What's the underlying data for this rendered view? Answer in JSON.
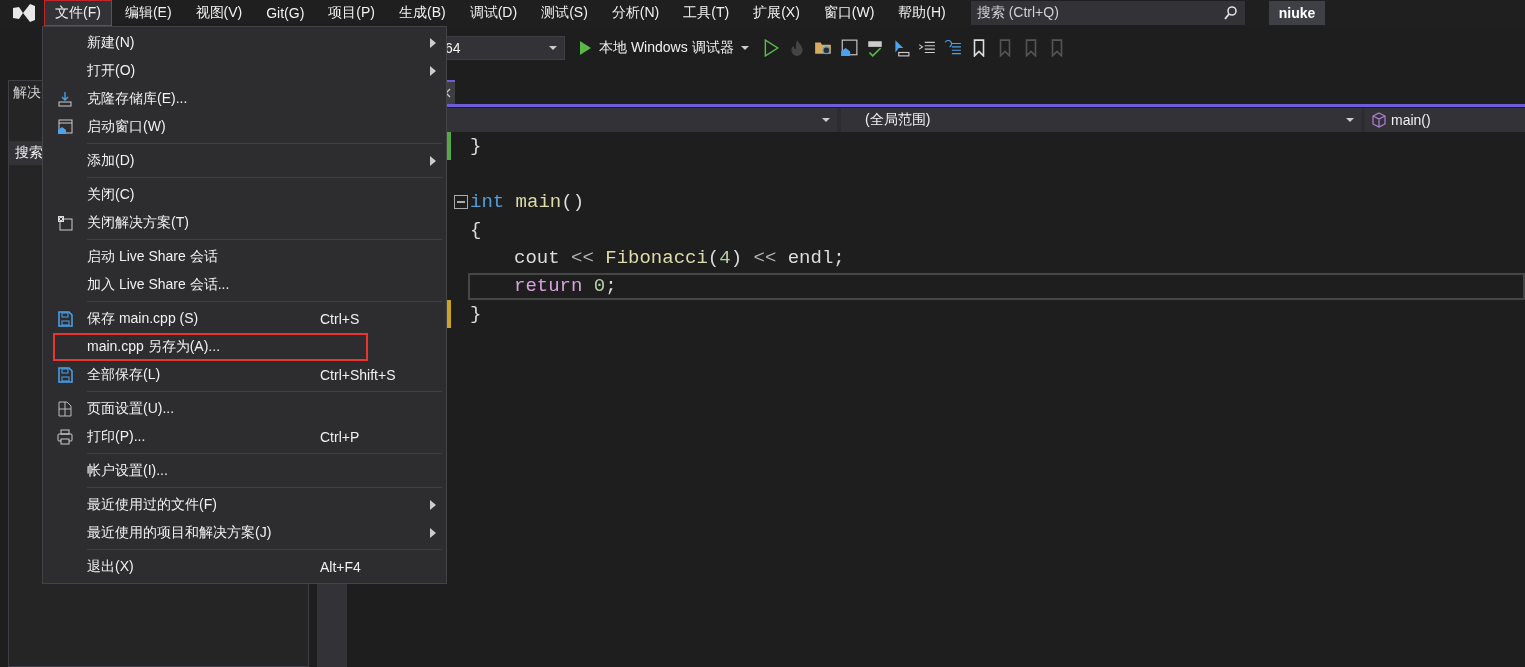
{
  "menubar": {
    "items": [
      {
        "label": "文件(F)",
        "selected": true
      },
      {
        "label": "编辑(E)",
        "selected": false
      },
      {
        "label": "视图(V)",
        "selected": false
      },
      {
        "label": "Git(G)",
        "selected": false
      },
      {
        "label": "项目(P)",
        "selected": false
      },
      {
        "label": "生成(B)",
        "selected": false
      },
      {
        "label": "调试(D)",
        "selected": false
      },
      {
        "label": "测试(S)",
        "selected": false
      },
      {
        "label": "分析(N)",
        "selected": false
      },
      {
        "label": "工具(T)",
        "selected": false
      },
      {
        "label": "扩展(X)",
        "selected": false
      },
      {
        "label": "窗口(W)",
        "selected": false
      },
      {
        "label": "帮助(H)",
        "selected": false
      }
    ],
    "search": {
      "placeholder": "搜索 (Ctrl+Q)"
    },
    "account": "niuke"
  },
  "toolbar": {
    "platform": "64",
    "run_label": "本地 Windows 调试器"
  },
  "solution_panel": {
    "title": "解决",
    "search_label": "搜索"
  },
  "editor": {
    "navbar": {
      "scope": "(全局范围)",
      "member": "main()"
    },
    "lines": [
      {
        "kind": "code",
        "color": "#57a64a",
        "fold": false,
        "indented": false,
        "current": false,
        "tokens": [
          {
            "kind": "punct",
            "text": "}"
          }
        ]
      },
      {
        "kind": "blank"
      },
      {
        "kind": "code",
        "fold": true,
        "indented": false,
        "current": false,
        "tokens": [
          {
            "kind": "keyword",
            "text": "int"
          },
          {
            "kind": "function",
            "text": "main"
          },
          {
            "kind": "punct",
            "text": "()"
          }
        ]
      },
      {
        "kind": "code",
        "fold": false,
        "indented": false,
        "current": false,
        "tokens": [
          {
            "kind": "punct",
            "text": "{"
          }
        ]
      },
      {
        "kind": "code",
        "fold": false,
        "indented": true,
        "current": false,
        "tokens": [
          {
            "kind": "variable",
            "text": "cout"
          },
          {
            "kind": "operator",
            "text": "<<"
          },
          {
            "kind": "function",
            "text": "Fibonacci"
          },
          {
            "kind": "punct",
            "text": "("
          },
          {
            "kind": "number",
            "text": "4"
          },
          {
            "kind": "punct",
            "text": ")"
          },
          {
            "kind": "operator",
            "text": "<<"
          },
          {
            "kind": "variable",
            "text": "endl"
          },
          {
            "kind": "punct",
            "text": ";"
          }
        ]
      },
      {
        "kind": "code",
        "fold": false,
        "indented": true,
        "current": true,
        "tokens": [
          {
            "kind": "control",
            "text": "return"
          },
          {
            "kind": "number",
            "text": "0"
          },
          {
            "kind": "punct",
            "text": ";"
          }
        ]
      },
      {
        "kind": "code",
        "color": "#c9a22a",
        "fold": false,
        "indented": false,
        "current": false,
        "tokens": [
          {
            "kind": "punct",
            "text": "}"
          }
        ]
      }
    ]
  },
  "file_menu": {
    "items": [
      {
        "kind": "item",
        "label": "新建(N)",
        "submenu": true,
        "highlighted": false
      },
      {
        "kind": "item",
        "label": "打开(O)",
        "submenu": true,
        "highlighted": false
      },
      {
        "kind": "item",
        "label": "克隆存储库(E)...",
        "submenu": false,
        "highlighted": false
      },
      {
        "kind": "item",
        "label": "启动窗口(W)",
        "submenu": false,
        "highlighted": false
      },
      {
        "kind": "separator"
      },
      {
        "kind": "item",
        "label": "添加(D)",
        "submenu": true,
        "highlighted": false
      },
      {
        "kind": "separator"
      },
      {
        "kind": "item",
        "label": "关闭(C)",
        "submenu": false,
        "highlighted": false
      },
      {
        "kind": "item",
        "label": "关闭解决方案(T)",
        "submenu": false,
        "highlighted": false
      },
      {
        "kind": "separator"
      },
      {
        "kind": "item",
        "label": "启动 Live Share 会话",
        "submenu": false,
        "highlighted": false
      },
      {
        "kind": "item",
        "label": "加入 Live Share 会话...",
        "submenu": false,
        "highlighted": false
      },
      {
        "kind": "separator"
      },
      {
        "kind": "item",
        "label": "保存 main.cpp (S)",
        "shortcut": "Ctrl+S",
        "submenu": false,
        "highlighted": false
      },
      {
        "kind": "item",
        "label": "main.cpp 另存为(A)...",
        "submenu": false,
        "highlighted": true
      },
      {
        "kind": "item",
        "label": "全部保存(L)",
        "shortcut": "Ctrl+Shift+S",
        "submenu": false,
        "highlighted": false
      },
      {
        "kind": "separator"
      },
      {
        "kind": "item",
        "label": "页面设置(U)...",
        "submenu": false,
        "highlighted": false
      },
      {
        "kind": "item",
        "label": "打印(P)...",
        "shortcut": "Ctrl+P",
        "submenu": false,
        "highlighted": false
      },
      {
        "kind": "separator"
      },
      {
        "kind": "item",
        "label": "帐户设置(I)...",
        "submenu": false,
        "highlighted": false
      },
      {
        "kind": "separator"
      },
      {
        "kind": "item",
        "label": "最近使用过的文件(F)",
        "submenu": true,
        "highlighted": false
      },
      {
        "kind": "item",
        "label": "最近使用的项目和解决方案(J)",
        "submenu": true,
        "highlighted": false
      },
      {
        "kind": "separator"
      },
      {
        "kind": "item",
        "label": "退出(X)",
        "shortcut": "Alt+F4",
        "submenu": false,
        "highlighted": false
      }
    ]
  }
}
